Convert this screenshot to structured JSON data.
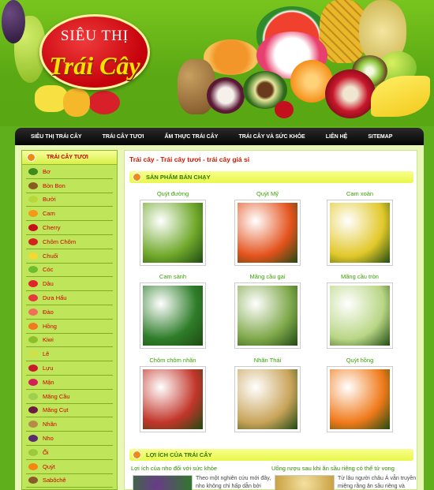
{
  "logo": {
    "top": "SIÊU THỊ",
    "main": "Trái Cây"
  },
  "nav": [
    "SIÊU THỊ TRÁI CÂY",
    "TRÁI CÂY TƯƠI",
    "ẨM THỰC TRÁI CÂY",
    "TRÁI CÂY VÀ SỨC KHỎE",
    "LIÊN HỆ",
    "SITEMAP"
  ],
  "sidebar": {
    "title": "TRÁI CÂY TƯƠI",
    "items": [
      {
        "label": "Bơ",
        "color": "#3f8a1e"
      },
      {
        "label": "Bòn Bon",
        "color": "#8a5a20"
      },
      {
        "label": "Bưởi",
        "color": "#b6d83a"
      },
      {
        "label": "Cam",
        "color": "#f49a16"
      },
      {
        "label": "Cherry",
        "color": "#c4101c"
      },
      {
        "label": "Chôm Chôm",
        "color": "#d2231e"
      },
      {
        "label": "Chuối",
        "color": "#f3d932"
      },
      {
        "label": "Cóc",
        "color": "#6fbd2e"
      },
      {
        "label": "Dâu",
        "color": "#e0242a"
      },
      {
        "label": "Dưa Hấu",
        "color": "#e33b3b"
      },
      {
        "label": "Đào",
        "color": "#f06f5a"
      },
      {
        "label": "Hồng",
        "color": "#f07a1e"
      },
      {
        "label": "Kiwi",
        "color": "#8bbf2c"
      },
      {
        "label": "Lê",
        "color": "#cfe04a"
      },
      {
        "label": "Lựu",
        "color": "#c81c2a"
      },
      {
        "label": "Mận",
        "color": "#d31f55"
      },
      {
        "label": "Măng Cầu",
        "color": "#9fcf4e"
      },
      {
        "label": "Măng Cụt",
        "color": "#6b1b40"
      },
      {
        "label": "Nhãn",
        "color": "#b58b48"
      },
      {
        "label": "Nho",
        "color": "#5a2c6e"
      },
      {
        "label": "Ổi",
        "color": "#9ac93a"
      },
      {
        "label": "Quýt",
        "color": "#f5850f"
      },
      {
        "label": "Sabôchê",
        "color": "#8a5a2a"
      }
    ]
  },
  "content": {
    "breadcrumb": "Trái cây - Trái cây tươi - trái cây giá sỉ",
    "bestsellers_title": "SẢN PHẨM BÁN CHẠY",
    "products": [
      {
        "name": "Quýt đường",
        "color": "#6fa82a"
      },
      {
        "name": "Quýt Mỹ",
        "color": "#e4521c"
      },
      {
        "name": "Cam xoàn",
        "color": "#e2c82a"
      },
      {
        "name": "Cam sành",
        "color": "#2e7d2a"
      },
      {
        "name": "Mãng cầu gai",
        "color": "#7fa84a"
      },
      {
        "name": "Mãng cầu tròn",
        "color": "#b9d685"
      },
      {
        "name": "Chôm chôm nhãn",
        "color": "#c2352a"
      },
      {
        "name": "Nhãn Thái",
        "color": "#c9a45a"
      },
      {
        "name": "Quýt hồng",
        "color": "#f07a1a"
      }
    ],
    "benefits_title": "LỢI ÍCH CỦA TRÁI CÂY",
    "articles": [
      {
        "title": "Lợi ích của nho đối với sức khỏe",
        "text1": "Theo một nghiên cứu mới đây,",
        "text2": "nho không chỉ hấp dẫn bởi"
      },
      {
        "title": "Uống rượu sau khi ăn sầu riêng có thể tử vong",
        "text1": "Từ lâu người châu Á vẫn truyền",
        "text2": "miệng rằng ăn sầu riêng và"
      }
    ]
  }
}
